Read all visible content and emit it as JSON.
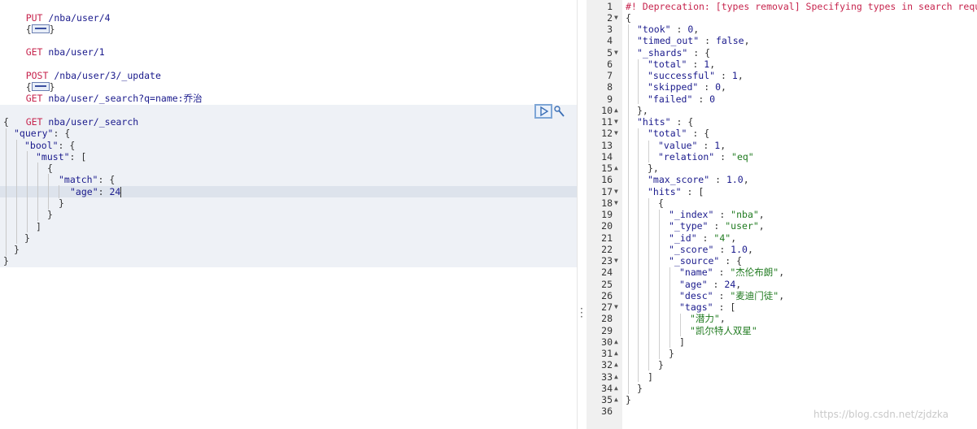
{
  "request_editor": {
    "req1": {
      "method": "PUT",
      "path": "/nba/user/4"
    },
    "req2": {
      "method": "GET",
      "path": "nba/user/1"
    },
    "req3": {
      "method": "POST",
      "path": "/nba/user/3/_update"
    },
    "req4": {
      "method": "GET",
      "path": "nba/user/_search?q=name:乔治"
    },
    "req5": {
      "method": "GET",
      "path": "nba/user/_search"
    },
    "body": {
      "open": "{",
      "query_key": "\"query\"",
      "bool_key": "\"bool\"",
      "must_key": "\"must\"",
      "match_key": "\"match\"",
      "age_key": "\"age\"",
      "age_value": "24"
    }
  },
  "response_viewer": {
    "line_numbers": [
      "1",
      "2",
      "3",
      "4",
      "5",
      "6",
      "7",
      "8",
      "9",
      "10",
      "11",
      "12",
      "13",
      "14",
      "15",
      "16",
      "17",
      "18",
      "19",
      "20",
      "21",
      "22",
      "23",
      "24",
      "25",
      "26",
      "27",
      "28",
      "29",
      "30",
      "31",
      "32",
      "33",
      "34",
      "35",
      "36"
    ],
    "deprecation": "#! Deprecation: [types removal] Specifying types in search requ",
    "took": "0",
    "timed_out": "false",
    "shards_total": "1",
    "shards_successful": "1",
    "shards_skipped": "0",
    "shards_failed": "0",
    "hits_total_value": "1",
    "hits_total_relation": "\"eq\"",
    "max_score": "1.0",
    "hit_index": "\"nba\"",
    "hit_type": "\"user\"",
    "hit_id": "\"4\"",
    "hit_score": "1.0",
    "source_name": "\"杰伦布朗\"",
    "source_age": "24",
    "source_desc": "\"麦迪门徒\"",
    "tag_1": "\"潜力\"",
    "tag_2": "\"凯尔特人双星\""
  },
  "watermark": "https://blog.csdn.net/zjdzka"
}
